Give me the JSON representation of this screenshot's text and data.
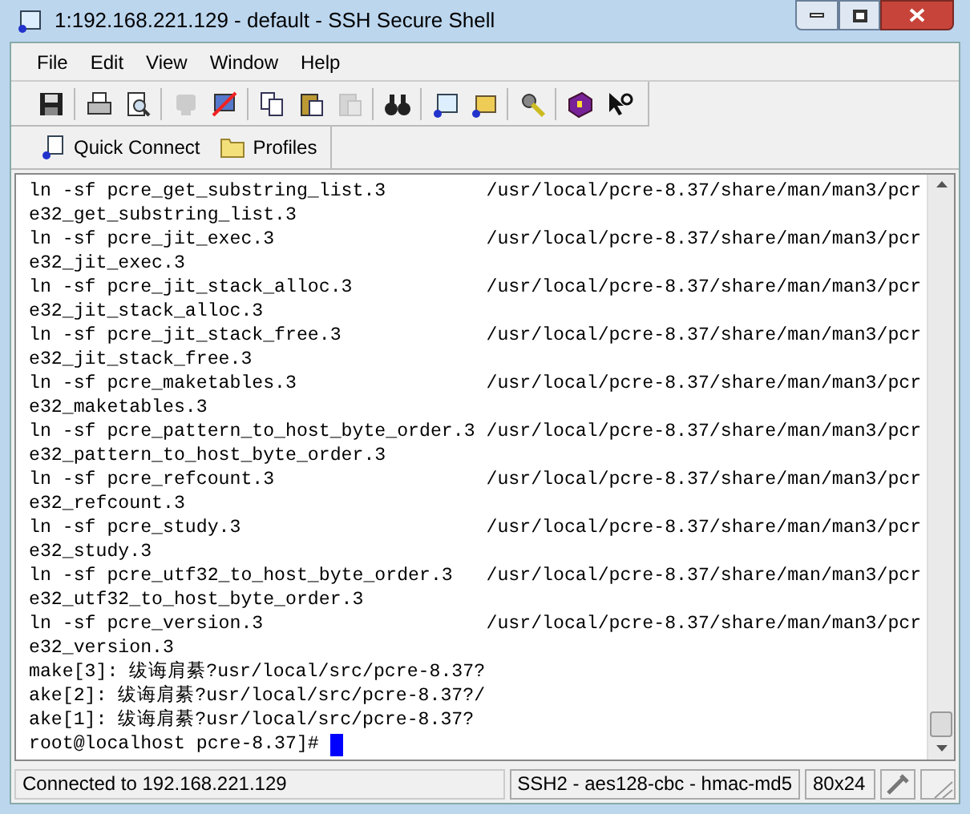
{
  "window": {
    "title": "1:192.168.221.129 - default - SSH Secure Shell"
  },
  "menu": [
    "File",
    "Edit",
    "View",
    "Window",
    "Help"
  ],
  "toolbar": [
    [
      {
        "kind": "save",
        "disabled": false
      }
    ],
    [
      {
        "kind": "print",
        "disabled": false
      },
      {
        "kind": "preview",
        "disabled": false
      }
    ],
    [
      {
        "kind": "connect",
        "disabled": true
      },
      {
        "kind": "disconnect",
        "disabled": false
      }
    ],
    [
      {
        "kind": "copy",
        "disabled": false
      },
      {
        "kind": "paste",
        "disabled": false
      },
      {
        "kind": "pastealt",
        "disabled": true
      }
    ],
    [
      {
        "kind": "find",
        "disabled": false
      }
    ],
    [
      {
        "kind": "terminal",
        "disabled": false
      },
      {
        "kind": "transfer",
        "disabled": false
      }
    ],
    [
      {
        "kind": "settings",
        "disabled": false
      }
    ],
    [
      {
        "kind": "help",
        "disabled": false
      },
      {
        "kind": "whatsthis",
        "disabled": false
      }
    ]
  ],
  "quickbar": [
    {
      "kind": "connect",
      "label": "Quick Connect"
    },
    {
      "kind": "folder",
      "label": "Profiles"
    }
  ],
  "terminal": {
    "lines": [
      "ln -sf pcre_get_substring_list.3         /usr/local/pcre-8.37/share/man/man3/pcr",
      "e32_get_substring_list.3",
      "ln -sf pcre_jit_exec.3                   /usr/local/pcre-8.37/share/man/man3/pcr",
      "e32_jit_exec.3",
      "ln -sf pcre_jit_stack_alloc.3            /usr/local/pcre-8.37/share/man/man3/pcr",
      "e32_jit_stack_alloc.3",
      "ln -sf pcre_jit_stack_free.3             /usr/local/pcre-8.37/share/man/man3/pcr",
      "e32_jit_stack_free.3",
      "ln -sf pcre_maketables.3                 /usr/local/pcre-8.37/share/man/man3/pcr",
      "e32_maketables.3",
      "ln -sf pcre_pattern_to_host_byte_order.3 /usr/local/pcre-8.37/share/man/man3/pcr",
      "e32_pattern_to_host_byte_order.3",
      "ln -sf pcre_refcount.3                   /usr/local/pcre-8.37/share/man/man3/pcr",
      "e32_refcount.3",
      "ln -sf pcre_study.3                      /usr/local/pcre-8.37/share/man/man3/pcr",
      "e32_study.3",
      "ln -sf pcre_utf32_to_host_byte_order.3   /usr/local/pcre-8.37/share/man/man3/pcr",
      "e32_utf32_to_host_byte_order.3",
      "ln -sf pcre_version.3                    /usr/local/pcre-8.37/share/man/man3/pcr",
      "e32_version.3",
      "make[3]: 绂诲肩綦?usr/local/src/pcre-8.37?",
      "ake[2]: 绂诲肩綦?usr/local/src/pcre-8.37?/",
      "ake[1]: 绂诲肩綦?usr/local/src/pcre-8.37?"
    ],
    "prompt": "root@localhost pcre-8.37]# "
  },
  "status_bar": {
    "connection": "Connected to 192.168.221.129",
    "cipher": "SSH2 - aes128-cbc - hmac-md5",
    "size": "80x24"
  }
}
